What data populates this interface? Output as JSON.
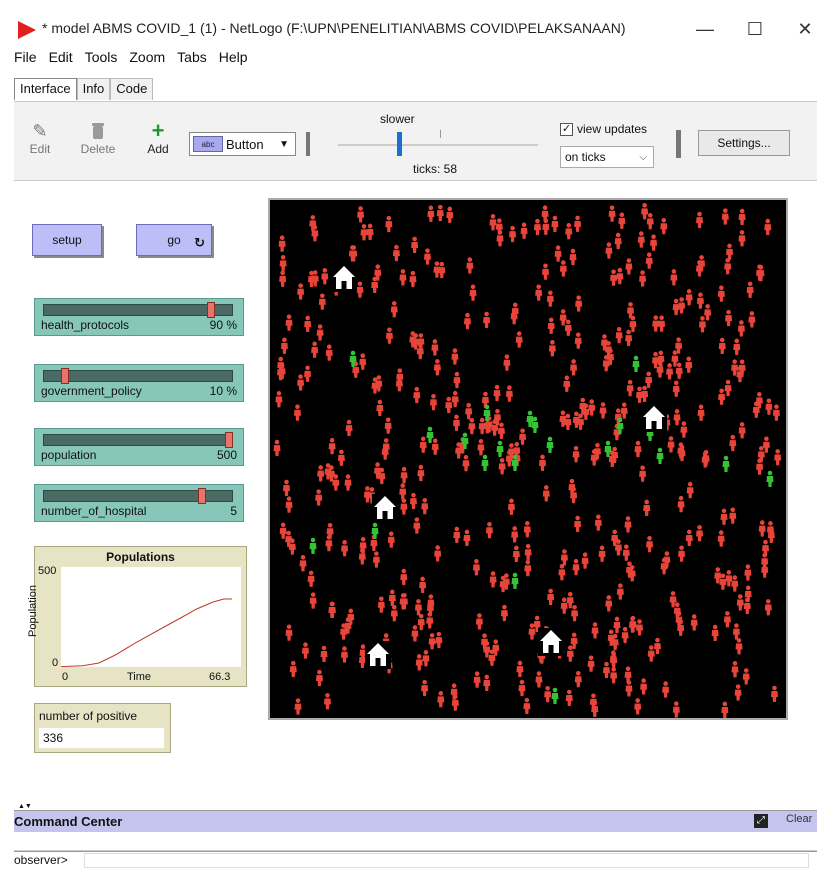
{
  "window": {
    "title": "* model ABMS COVID_1 (1) - NetLogo (F:\\UPN\\PENELITIAN\\ABMS COVID\\PELAKSANAAN)",
    "minimize": "—",
    "maximize": "☐",
    "close": "✕",
    "accent": "#e0201f"
  },
  "menu": [
    "File",
    "Edit",
    "Tools",
    "Zoom",
    "Tabs",
    "Help"
  ],
  "tabs": [
    "Interface",
    "Info",
    "Code"
  ],
  "toolbar": {
    "edit_label": "Edit",
    "delete_label": "Delete",
    "add_label": "Add",
    "widget_type": "Button",
    "widget_icon_text": "abc",
    "speed_label": "slower",
    "ticks_label": "ticks: 58",
    "view_updates_label": "view updates",
    "view_updates_checked": true,
    "update_mode": "on ticks",
    "settings_label": "Settings..."
  },
  "buttons": {
    "setup": "setup",
    "go": "go",
    "go_forever_icon": "↻"
  },
  "sliders": [
    {
      "name": "health_protocols",
      "value_text": "90 %",
      "fraction": 0.9
    },
    {
      "name": "government_policy",
      "value_text": "10 %",
      "fraction": 0.1
    },
    {
      "name": "population",
      "value_text": "500",
      "fraction": 1.0
    },
    {
      "name": "number_of_hospital",
      "value_text": "5",
      "fraction": 0.85
    }
  ],
  "plot": {
    "title": "Populations",
    "ylabel": "Population",
    "xlabel": "Time",
    "ymax_label": "500",
    "ymin_label": "0",
    "xmin_label": "0",
    "xmax_label": "66.3"
  },
  "chart_data": {
    "type": "line",
    "title": "Populations",
    "xlabel": "Time",
    "ylabel": "Population",
    "xlim": [
      0,
      66.3
    ],
    "ylim": [
      0,
      500
    ],
    "series": [
      {
        "color": "#c0392b",
        "x": [
          0,
          8,
          14,
          20,
          28,
          36,
          44,
          50,
          56,
          60,
          63
        ],
        "y": [
          2,
          6,
          20,
          60,
          125,
          185,
          245,
          290,
          325,
          340,
          340
        ]
      }
    ]
  },
  "monitor": {
    "label": "number of positive",
    "value": "336"
  },
  "world": {
    "background": "#000000",
    "infected_color": "#e8443a",
    "healthy_color": "#35c235",
    "hospital_color": "#ffffff"
  },
  "command_center": {
    "title": "Command Center",
    "clear_label": "Clear",
    "prompt": "observer>"
  }
}
